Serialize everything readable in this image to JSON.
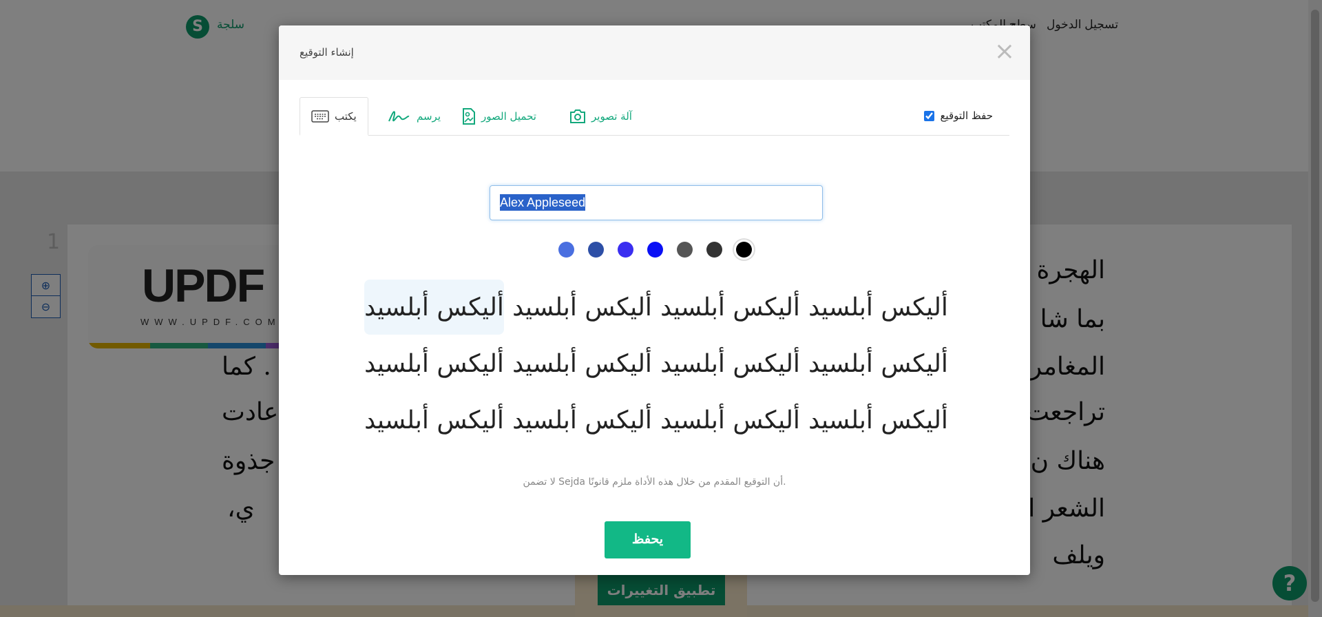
{
  "background": {
    "brand": "سلجة",
    "brand_logo_letter": "S",
    "nav": [
      "تسجيل الدخول",
      "سطح المكتب"
    ],
    "page_number": "1",
    "updf_logo": "UPDF",
    "updf_url": "WWW.UPDF.COM",
    "page_lines_right": [
      "الهجرة",
      "بما شا",
      "المغامر",
      "تراجعت",
      "هناك ن",
      "الشعر ا",
      "ويلف"
    ],
    "page_lines_left": [
      ". كما",
      "عادت",
      "جذوة",
      "ي،"
    ],
    "apply_button": "تطبيق التغييرات",
    "help_button": "?"
  },
  "modal": {
    "title": "إنشاء التوقيع",
    "close": "×",
    "tabs": [
      {
        "label": "يكتب",
        "icon": "keyboard-icon",
        "active": true
      },
      {
        "label": "يرسم",
        "icon": "signature-draw-icon",
        "active": false
      },
      {
        "label": "تحميل الصور",
        "icon": "image-upload-icon",
        "active": false
      },
      {
        "label": "آلة تصوير",
        "icon": "camera-icon",
        "active": false
      }
    ],
    "keep_signature_label": "حفظ التوقيع",
    "keep_signature_checked": true,
    "name_value": "Alex Appleseed",
    "colors": [
      "#4a6fe0",
      "#2d4fa6",
      "#3a2ef0",
      "#0a10f5",
      "#555555",
      "#333333",
      "#000000"
    ],
    "selected_color": "#000000",
    "signature_options": [
      "أليكس أبلسيد",
      "أليكس أبلسيد",
      "أليكس أبلسيد",
      "أليكس أبلسيد",
      "أليكس أبلسيد",
      "أليكس أبلسيد",
      "أليكس أبلسيد",
      "أليكس أبلسيد",
      "أليكس أبلسيد",
      "أليكس أبلسيد",
      "أليكس أبلسيد",
      "أليكس أبلسيد"
    ],
    "selected_option_index": 3,
    "disclaimer": ".أن التوقيع المقدم من خلال هذه الأداة ملزم قانونًا Sejda لا تضمن",
    "save_button": "يحفظ"
  }
}
